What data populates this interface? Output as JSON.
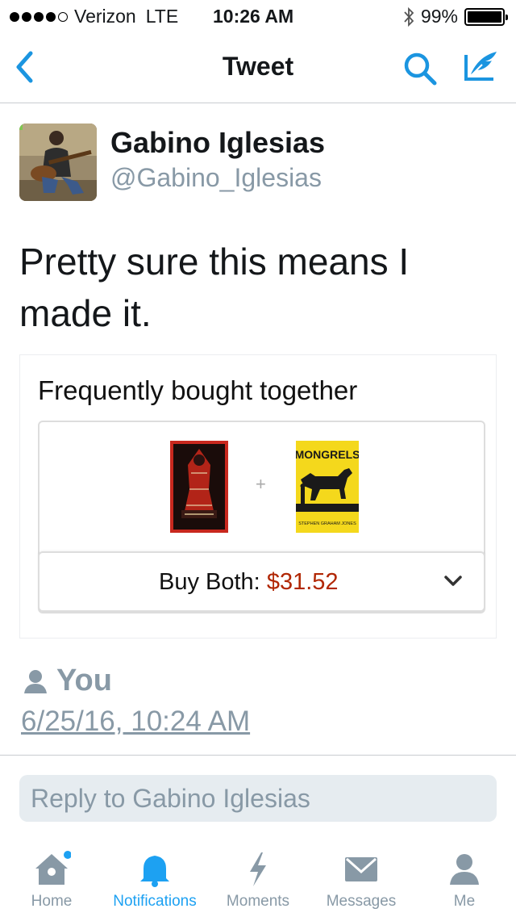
{
  "status_bar": {
    "carrier": "Verizon",
    "network": "LTE",
    "time": "10:26 AM",
    "battery": "99%",
    "battery_level": 0.99,
    "signal_bars": 4
  },
  "nav": {
    "title": "Tweet",
    "icons": [
      "back-chevron-icon",
      "search-icon",
      "compose-icon"
    ]
  },
  "tweet": {
    "display_name": "Gabino Iglesias",
    "handle": "@Gabino_Iglesias",
    "text": "Pretty sure this means I made it.",
    "timestamp": "6/25/16, 10:24 AM",
    "retweeted_by": "You"
  },
  "media": {
    "heading": "Frequently bought together",
    "plus": "+",
    "book2_title": "MONGRELS",
    "book2_author": "STEPHEN GRAHAM JONES",
    "buy_label": "Buy Both:",
    "buy_price": "$31.52",
    "price_color": "#b12704"
  },
  "reply": {
    "placeholder": "Reply to Gabino Iglesias"
  },
  "tabs": [
    {
      "label": "Home",
      "icon": "home-icon",
      "active": false,
      "badge": true
    },
    {
      "label": "Notifications",
      "icon": "bell-icon",
      "active": true,
      "badge": false
    },
    {
      "label": "Moments",
      "icon": "lightning-icon",
      "active": false,
      "badge": false
    },
    {
      "label": "Messages",
      "icon": "envelope-icon",
      "active": false,
      "badge": false
    },
    {
      "label": "Me",
      "icon": "person-icon",
      "active": false,
      "badge": false
    }
  ],
  "colors": {
    "accent": "#1da1f2",
    "nav_icon": "#1b95e0",
    "muted": "#8899a6",
    "text": "#14171a"
  }
}
